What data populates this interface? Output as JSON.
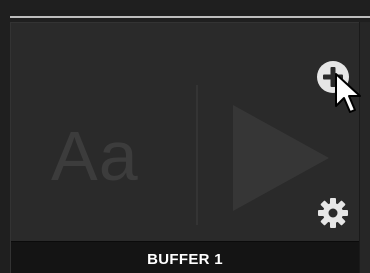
{
  "buffer_tile": {
    "label": "BUFFER 1",
    "preview_text": "Aa",
    "icons": {
      "add": "plus-circle-icon",
      "settings": "gear-icon",
      "play": "play-icon",
      "cursor": "mouse-pointer-icon"
    }
  },
  "colors": {
    "background": "#1f1f1f",
    "tile": "#2a2a2a",
    "label_bar": "#141414",
    "label_text": "#ffffff",
    "icon": "#e6e6e6",
    "ghost": "#3c3c3c"
  }
}
